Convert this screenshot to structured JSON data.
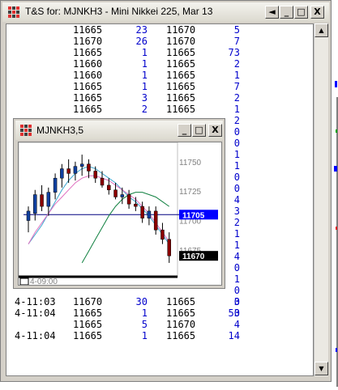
{
  "window": {
    "title": "T&S for: MJNKH3 - Mini Nikkei 225, Mar 13",
    "buttons": [
      "◄",
      "_",
      "□",
      "X"
    ]
  },
  "trades_top": [
    {
      "time": "",
      "bid": "11665",
      "bid_size": "23",
      "ask": "11670",
      "ask_size": "5"
    },
    {
      "time": "",
      "bid": "11670",
      "bid_size": "26",
      "ask": "11670",
      "ask_size": "7"
    },
    {
      "time": "",
      "bid": "11665",
      "bid_size": "1",
      "ask": "11665",
      "ask_size": "73"
    },
    {
      "time": "",
      "bid": "11660",
      "bid_size": "1",
      "ask": "11665",
      "ask_size": "2"
    },
    {
      "time": "",
      "bid": "11660",
      "bid_size": "1",
      "ask": "11665",
      "ask_size": "1"
    },
    {
      "time": "",
      "bid": "11665",
      "bid_size": "1",
      "ask": "11665",
      "ask_size": "7"
    },
    {
      "time": "",
      "bid": "11665",
      "bid_size": "3",
      "ask": "11665",
      "ask_size": "2"
    },
    {
      "time": "",
      "bid": "11665",
      "bid_size": "2",
      "ask": "11665",
      "ask_size": "1"
    }
  ],
  "hidden_ask_sizes": [
    "2",
    "0",
    "0",
    "1",
    "1",
    "0",
    "0",
    "4",
    "3",
    "2",
    "1",
    "1",
    "4",
    "0",
    "1",
    "0",
    "0",
    "3"
  ],
  "trades_bottom": [
    {
      "time": "4-11:03",
      "bid": "11670",
      "bid_size": "30",
      "ask": "11665",
      "ask_size": "3"
    },
    {
      "time": "4-11:04",
      "bid": "11665",
      "bid_size": "1",
      "ask": "11665",
      "ask_size": "50"
    },
    {
      "time": "",
      "bid": "11665",
      "bid_size": "5",
      "ask": "11670",
      "ask_size": "4"
    },
    {
      "time": "4-11:04",
      "bid": "11665",
      "bid_size": "1",
      "ask": "11665",
      "ask_size": "14"
    }
  ],
  "chart_window": {
    "title": "MJNKH3,5",
    "buttons": [
      "_",
      "□",
      "X"
    ],
    "time_label": "4-09:00",
    "price_labels": [
      "11750",
      "11725",
      "11700",
      "11675"
    ],
    "current_bid_label": "11705",
    "last_price_label": "11670",
    "colors": {
      "bid_box": "#0000ff",
      "last_box": "#000000",
      "ma_fast": "#e070c0",
      "ma_mid": "#40a8d0",
      "ma_slow": "#108040",
      "hline": "#000080"
    }
  },
  "chart_data": {
    "type": "candlestick",
    "symbol": "MJNKH3",
    "interval": "5",
    "ylim": [
      11655,
      11765
    ],
    "reference_line": 11705,
    "candles": [
      {
        "o": 11700,
        "h": 11712,
        "l": 11690,
        "c": 11708
      },
      {
        "o": 11706,
        "h": 11726,
        "l": 11700,
        "c": 11722
      },
      {
        "o": 11722,
        "h": 11730,
        "l": 11708,
        "c": 11712
      },
      {
        "o": 11712,
        "h": 11728,
        "l": 11704,
        "c": 11724
      },
      {
        "o": 11724,
        "h": 11740,
        "l": 11718,
        "c": 11736
      },
      {
        "o": 11736,
        "h": 11748,
        "l": 11728,
        "c": 11744
      },
      {
        "o": 11744,
        "h": 11752,
        "l": 11732,
        "c": 11740
      },
      {
        "o": 11740,
        "h": 11750,
        "l": 11734,
        "c": 11746
      },
      {
        "o": 11746,
        "h": 11756,
        "l": 11738,
        "c": 11748
      },
      {
        "o": 11748,
        "h": 11752,
        "l": 11736,
        "c": 11742
      },
      {
        "o": 11742,
        "h": 11746,
        "l": 11732,
        "c": 11736
      },
      {
        "o": 11736,
        "h": 11742,
        "l": 11728,
        "c": 11730
      },
      {
        "o": 11730,
        "h": 11736,
        "l": 11722,
        "c": 11726
      },
      {
        "o": 11726,
        "h": 11732,
        "l": 11718,
        "c": 11720
      },
      {
        "o": 11720,
        "h": 11728,
        "l": 11714,
        "c": 11722
      },
      {
        "o": 11722,
        "h": 11726,
        "l": 11710,
        "c": 11714
      },
      {
        "o": 11714,
        "h": 11720,
        "l": 11708,
        "c": 11712
      },
      {
        "o": 11712,
        "h": 11716,
        "l": 11698,
        "c": 11702
      },
      {
        "o": 11702,
        "h": 11712,
        "l": 11696,
        "c": 11708
      },
      {
        "o": 11708,
        "h": 11712,
        "l": 11688,
        "c": 11692
      },
      {
        "o": 11692,
        "h": 11698,
        "l": 11680,
        "c": 11684
      },
      {
        "o": 11684,
        "h": 11690,
        "l": 11664,
        "c": 11670
      }
    ],
    "ma_fast": [
      11680,
      11690,
      11698,
      11706,
      11714,
      11720,
      11726,
      11732,
      11736,
      11738,
      11738,
      11736,
      11734,
      11730,
      11726,
      11722,
      11718,
      11712,
      11706,
      11698,
      11690,
      11682
    ],
    "ma_mid": [
      11680,
      11688,
      11696,
      11706,
      11716,
      11726,
      11734,
      11740,
      11744,
      11746,
      11744,
      11740,
      11736,
      11732,
      11726,
      11720,
      11716,
      11710,
      11704,
      11696,
      11688,
      11680
    ],
    "ma_slow": [
      null,
      null,
      null,
      null,
      null,
      null,
      null,
      null,
      11664,
      11674,
      11684,
      11694,
      11704,
      11712,
      11718,
      11722,
      11724,
      11724,
      11722,
      11720,
      11716,
      11712
    ]
  }
}
